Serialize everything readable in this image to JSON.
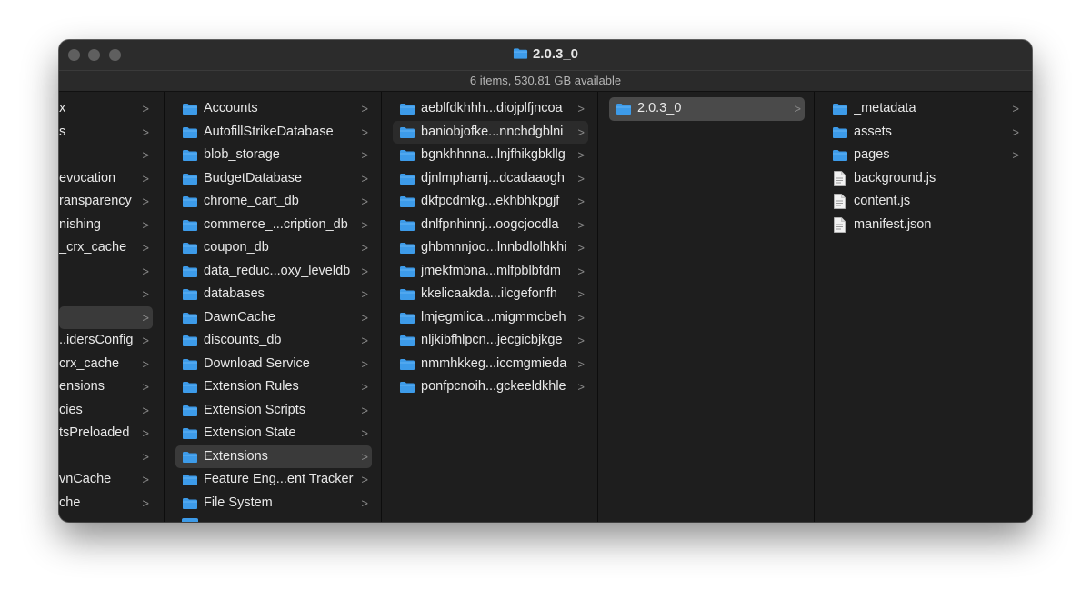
{
  "window": {
    "title": "2.0.3_0",
    "status": "6 items, 530.81 GB available"
  },
  "columns": [
    {
      "items": [
        {
          "name": "x",
          "chevron": true
        },
        {
          "name": "s",
          "chevron": true
        },
        {
          "name": "",
          "chevron": true
        },
        {
          "name": "evocation",
          "chevron": true
        },
        {
          "name": "ransparency",
          "chevron": true
        },
        {
          "name": "nishing",
          "chevron": true
        },
        {
          "name": "_crx_cache",
          "chevron": true
        },
        {
          "name": "",
          "chevron": true
        },
        {
          "name": "",
          "chevron": true
        },
        {
          "name": "",
          "chevron": true,
          "selected": true
        },
        {
          "name": "..idersConfig",
          "chevron": true
        },
        {
          "name": "crx_cache",
          "chevron": true
        },
        {
          "name": "ensions",
          "chevron": true
        },
        {
          "name": "cies",
          "chevron": true
        },
        {
          "name": "tsPreloaded",
          "chevron": true
        },
        {
          "name": "",
          "chevron": true
        },
        {
          "name": "vnCache",
          "chevron": true
        },
        {
          "name": "che",
          "chevron": true
        }
      ]
    },
    {
      "items": [
        {
          "name": "Accounts",
          "type": "folder"
        },
        {
          "name": "AutofillStrikeDatabase",
          "type": "folder"
        },
        {
          "name": "blob_storage",
          "type": "folder"
        },
        {
          "name": "BudgetDatabase",
          "type": "folder"
        },
        {
          "name": "chrome_cart_db",
          "type": "folder"
        },
        {
          "name": "commerce_...cription_db",
          "type": "folder"
        },
        {
          "name": "coupon_db",
          "type": "folder"
        },
        {
          "name": "data_reduc...oxy_leveldb",
          "type": "folder"
        },
        {
          "name": "databases",
          "type": "folder"
        },
        {
          "name": "DawnCache",
          "type": "folder"
        },
        {
          "name": "discounts_db",
          "type": "folder"
        },
        {
          "name": "Download Service",
          "type": "folder"
        },
        {
          "name": "Extension Rules",
          "type": "folder"
        },
        {
          "name": "Extension Scripts",
          "type": "folder"
        },
        {
          "name": "Extension State",
          "type": "folder"
        },
        {
          "name": "Extensions",
          "type": "folder",
          "selected": true
        },
        {
          "name": "Feature Eng...ent Tracker",
          "type": "folder"
        },
        {
          "name": "File System",
          "type": "folder"
        }
      ]
    },
    {
      "items": [
        {
          "name": "aeblfdkhhh...diojplfjncoa",
          "type": "folder"
        },
        {
          "name": "baniobjofke...nnchdgblni",
          "type": "folder",
          "selected": true
        },
        {
          "name": "bgnkhhnna...lnjfhikgbkllg",
          "type": "folder"
        },
        {
          "name": "djnlmphamj...dcadaaogh",
          "type": "folder"
        },
        {
          "name": "dkfpcdmkg...ekhbhkpgjf",
          "type": "folder"
        },
        {
          "name": "dnlfpnhinnj...oogcjocdla",
          "type": "folder"
        },
        {
          "name": "ghbmnnjoo...lnnbdlolhkhi",
          "type": "folder"
        },
        {
          "name": "jmekfmbna...mlfpblbfdm",
          "type": "folder"
        },
        {
          "name": "kkelicaakda...ilcgefonfh",
          "type": "folder"
        },
        {
          "name": "lmjegmlica...migmmcbeh",
          "type": "folder"
        },
        {
          "name": "nljkibfhlpcn...jecgicbjkge",
          "type": "folder"
        },
        {
          "name": "nmmhkkeg...iccmgmieda",
          "type": "folder"
        },
        {
          "name": "ponfpcnoih...gckeeldkhle",
          "type": "folder"
        }
      ]
    },
    {
      "items": [
        {
          "name": "2.0.3_0",
          "type": "folder",
          "selected": true
        }
      ]
    },
    {
      "items": [
        {
          "name": "_metadata",
          "type": "folder"
        },
        {
          "name": "assets",
          "type": "folder"
        },
        {
          "name": "pages",
          "type": "folder"
        },
        {
          "name": "background.js",
          "type": "file"
        },
        {
          "name": "content.js",
          "type": "file"
        },
        {
          "name": "manifest.json",
          "type": "file"
        }
      ]
    }
  ],
  "chevron_glyph": ">",
  "colors": {
    "folder": "#3d9be9",
    "folder_tab": "#64b3f4",
    "window_bg": "#1e1e1e",
    "selection": "#4a4a4a"
  }
}
